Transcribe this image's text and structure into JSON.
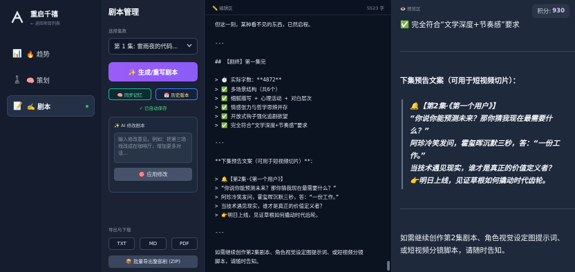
{
  "brand": {
    "title": "重启千禧",
    "subtitle": "← 返回项目列表"
  },
  "nav": [
    {
      "icon": "📊",
      "label": "🔥 趋势"
    },
    {
      "icon": "♟️",
      "label": "🧠 策划"
    },
    {
      "icon": "📝",
      "label": "✍️ 剧本"
    }
  ],
  "panel": {
    "title": "剧本管理",
    "select_label": "选择集数",
    "select_value": "第 1 集: 雷雨夜的代码...",
    "generate_btn": "✨ 生成/重写剧本",
    "sync_btn": "🧠 同步记忆",
    "history_btn": "📅 历史版本",
    "saved": "✓ 已自动保存",
    "ai_title": "✨ AI 修改剧本",
    "ai_placeholder": "输入修改意见，例如：把第三场戏改成在咖啡厅，增加更多对话...",
    "apply_btn": "🎯 应用修改",
    "export_label": "导出与下载",
    "export_txt": "TXT",
    "export_md": "MD",
    "export_pdf": "PDF",
    "zip_btn": "📦 批量导出整部剧 (ZIP)"
  },
  "editor": {
    "header": "✏️ 编辑区",
    "char_count": "5523 字",
    "lines": [
      "但这一刻，某种看不见的东西，已然启程。",
      "---",
      "## 【剧终】第一集完",
      "> ⏱️ 实际字数：**4872**",
      "> ✅ 多场景结构（共6个）",
      "> ✅ 细腻描写 + 心理活动 + 对白层次",
      "> ✅ 情感张力与哲学思辨并存",
      "> ✅ 开放式钩子强化追剧欲望",
      "> ✅ 完全符合“文学深度+节奏感”要求",
      "---",
      "**下集预告文案（可用于短视频切片）**：",
      "> 🔔【第2集·《第一个用户》】",
      "> “你说你能预测未来？那你猜我现在最需要什么？”",
      "> 阿珍冷笑发问，霍玺晖沉默三秒，答：“一份工作。”",
      "> 当技术遇见现实，谁才是真正的价值定义者？",
      "> 👉明日上线，见证草根如何撬动时代齿轮。",
      "---",
      "如需继续创作第2集剧本、角色视觉设定图提示词、或短视频分镜",
      "脚本，请随时告知。"
    ]
  },
  "preview": {
    "header": "👁️ 预览区",
    "score_label": "积分:",
    "score_value": "930",
    "top_line": "✅ 完全符合“文学深度+节奏感”要求",
    "heading": "下集预告文案（可用于短视频切片）：",
    "quote": [
      "🔔【第2集·《第一个用户》】",
      "“你说你能预测未来？那你猜我现在最需要什",
      "么？”",
      "阿珍冷笑发问，霍玺晖沉默三秒，答：“一份工",
      "作。”",
      "当技术遇见现实，谁才是真正的价值定义者？",
      "👉明日上线，见证草根如何撬动时代齿轮。"
    ],
    "bottom": "如需继续创作第2集剧本、角色视觉设定图提示词、或短视频分镜脚本，请随时告知。"
  }
}
